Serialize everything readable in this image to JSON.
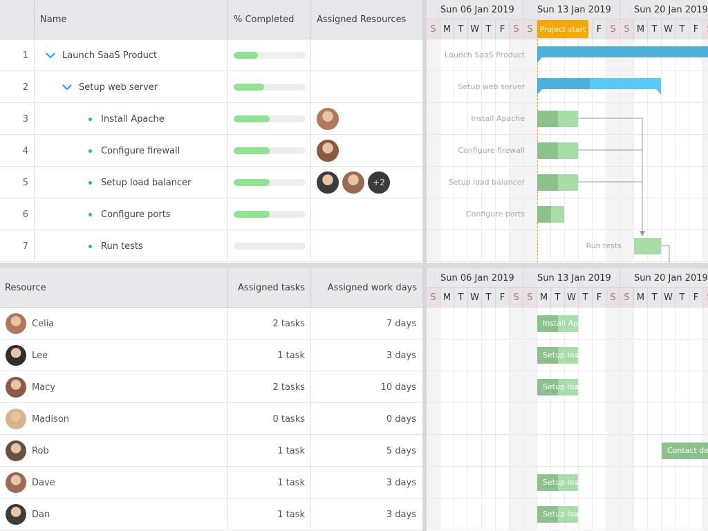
{
  "task_grid": {
    "headers": {
      "num": "",
      "name": "Name",
      "pct": "% Completed",
      "res": "Assigned Resources"
    },
    "rows": [
      {
        "num": "1",
        "name": "Launch SaaS Product",
        "progress": 0.34,
        "level": 0,
        "type": "parent"
      },
      {
        "num": "2",
        "name": "Setup web server",
        "progress": 0.42,
        "level": 1,
        "type": "parent"
      },
      {
        "num": "3",
        "name": "Install Apache",
        "progress": 0.5,
        "level": 2,
        "type": "leaf",
        "avatars": [
          "#b07a5a"
        ]
      },
      {
        "num": "4",
        "name": "Configure firewall",
        "progress": 0.5,
        "level": 2,
        "type": "leaf",
        "avatars": [
          "#8a5a44"
        ]
      },
      {
        "num": "5",
        "name": "Setup load balancer",
        "progress": 0.5,
        "level": 2,
        "type": "leaf",
        "avatars": [
          "#3b3b3b",
          "#9a6b53"
        ],
        "extra": "+2"
      },
      {
        "num": "6",
        "name": "Configure ports",
        "progress": 0.5,
        "level": 2,
        "type": "leaf"
      },
      {
        "num": "7",
        "name": "Run tests",
        "progress": 0,
        "level": 2,
        "type": "leaf"
      }
    ]
  },
  "timeline": {
    "weeks": [
      "Sun 06 Jan 2019",
      "Sun 13 Jan 2019",
      "Sun 20 Jan 2019"
    ],
    "day_letters": [
      "S",
      "M",
      "T",
      "W",
      "T",
      "F",
      "S",
      "S",
      "M",
      "T",
      "W",
      "T",
      "F",
      "S",
      "S",
      "M",
      "T",
      "W",
      "T",
      "F",
      "S"
    ],
    "milestone": "Project start",
    "task_labels": [
      "Launch SaaS Product",
      "Setup web server",
      "Install Apache",
      "Configure firewall",
      "Setup load balancer",
      "Configure ports",
      "Run tests"
    ]
  },
  "resource_grid": {
    "headers": {
      "resource": "Resource",
      "tasks": "Assigned tasks",
      "days": "Assigned work days"
    },
    "rows": [
      {
        "name": "Celia",
        "tasks": "2 tasks",
        "days": "7 days",
        "color": "#b07a5a"
      },
      {
        "name": "Lee",
        "tasks": "1 task",
        "days": "3 days",
        "color": "#2e2e2e"
      },
      {
        "name": "Macy",
        "tasks": "2 tasks",
        "days": "10 days",
        "color": "#8a5a44"
      },
      {
        "name": "Madison",
        "tasks": "0 tasks",
        "days": "0 days",
        "color": "#d9b38c"
      },
      {
        "name": "Rob",
        "tasks": "1 task",
        "days": "5 days",
        "color": "#6b5040"
      },
      {
        "name": "Dave",
        "tasks": "1 task",
        "days": "3 days",
        "color": "#9a6b53"
      },
      {
        "name": "Dan",
        "tasks": "1 task",
        "days": "3 days",
        "color": "#3b3b3b"
      }
    ]
  },
  "resource_timeline": {
    "bars": [
      "Install Ap",
      "Setup loa",
      "Setup loa",
      "Contact de",
      "Setup loa",
      "Setup loa"
    ]
  },
  "colors": {
    "accent": "#1aaee8",
    "progress": "#8fe28f",
    "milestone": "#f7a800",
    "parent_bar": "#4fb0db",
    "task_bar": "#a8dca8"
  }
}
